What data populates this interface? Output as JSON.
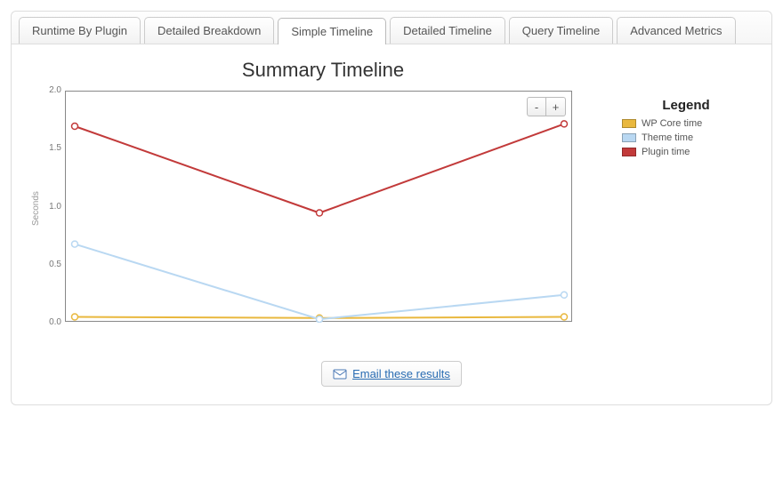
{
  "tabs": {
    "items": [
      {
        "label": "Runtime By Plugin",
        "active": false
      },
      {
        "label": "Detailed Breakdown",
        "active": false
      },
      {
        "label": "Simple Timeline",
        "active": true
      },
      {
        "label": "Detailed Timeline",
        "active": false
      },
      {
        "label": "Query Timeline",
        "active": false
      },
      {
        "label": "Advanced Metrics",
        "active": false
      }
    ]
  },
  "chart": {
    "title": "Summary Timeline",
    "ylabel": "Seconds",
    "yticks": [
      "2.0",
      "1.5",
      "1.0",
      "0.5",
      "0.0"
    ],
    "zoom_out": "-",
    "zoom_in": "+"
  },
  "legend": {
    "title": "Legend",
    "items": [
      {
        "label": "WP Core time",
        "color": "#e9b83e"
      },
      {
        "label": "Theme time",
        "color": "#b9d8f2"
      },
      {
        "label": "Plugin time",
        "color": "#c23a3a"
      }
    ]
  },
  "email": {
    "label": "Email these results"
  },
  "chart_data": {
    "type": "line",
    "title": "Summary Timeline",
    "ylabel": "Seconds",
    "xlabel": "",
    "ylim": [
      0.0,
      2.0
    ],
    "x": [
      1,
      2,
      3
    ],
    "series": [
      {
        "name": "WP Core time",
        "color": "#e9b83e",
        "values": [
          0.05,
          0.04,
          0.05
        ]
      },
      {
        "name": "Theme time",
        "color": "#b9d8f2",
        "values": [
          0.68,
          0.03,
          0.24
        ]
      },
      {
        "name": "Plugin time",
        "color": "#c23a3a",
        "values": [
          1.7,
          0.95,
          1.72
        ]
      }
    ]
  }
}
